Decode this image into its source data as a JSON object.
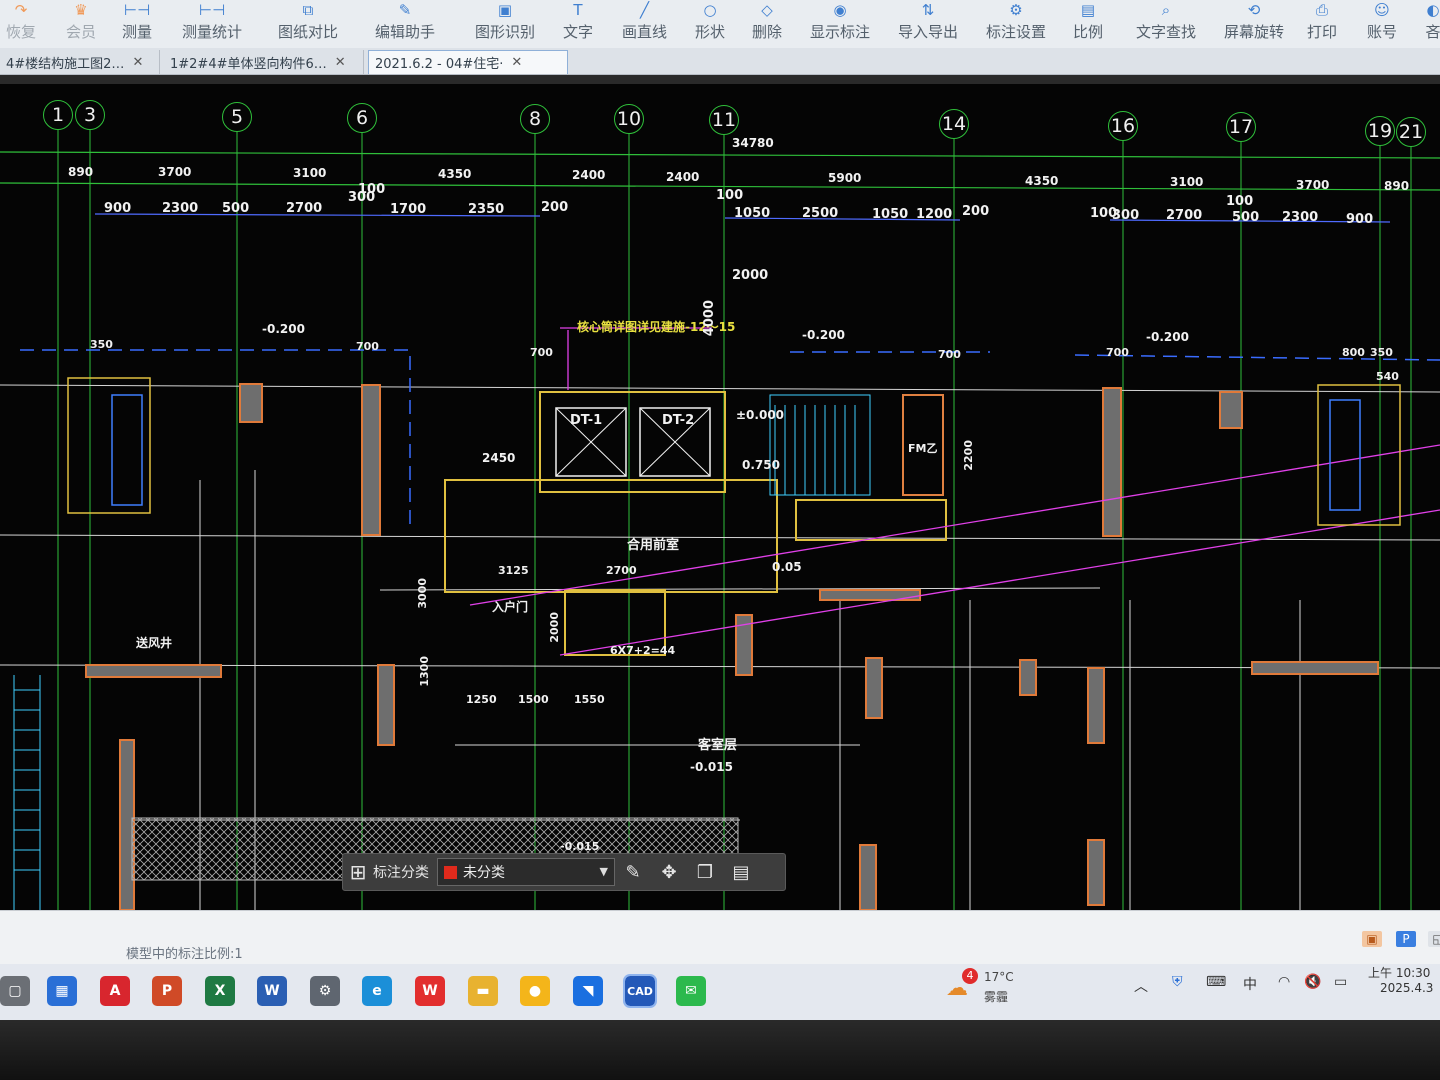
{
  "ribbon": {
    "items": [
      {
        "label": "恢复",
        "icon": "redo-icon",
        "dim": true
      },
      {
        "label": "会员",
        "icon": "vip-icon",
        "dim": true
      },
      {
        "label": "测量",
        "icon": "measure-icon"
      },
      {
        "label": "测量统计",
        "icon": "measure-stats-icon"
      },
      {
        "label": "图纸对比",
        "icon": "compare-icon"
      },
      {
        "label": "编辑助手",
        "icon": "edit-helper-icon"
      },
      {
        "label": "图形识别",
        "icon": "shape-recognize-icon"
      },
      {
        "label": "文字",
        "icon": "text-icon"
      },
      {
        "label": "画直线",
        "icon": "line-icon"
      },
      {
        "label": "形状",
        "icon": "shape-icon"
      },
      {
        "label": "删除",
        "icon": "eraser-icon"
      },
      {
        "label": "显示标注",
        "icon": "eye-icon"
      },
      {
        "label": "导入导出",
        "icon": "import-export-icon"
      },
      {
        "label": "标注设置",
        "icon": "annotation-settings-icon"
      },
      {
        "label": "比例",
        "icon": "scale-icon"
      },
      {
        "label": "文字查找",
        "icon": "text-search-icon"
      },
      {
        "label": "屏幕旋转",
        "icon": "rotate-screen-icon"
      },
      {
        "label": "打印",
        "icon": "printer-icon"
      },
      {
        "label": "账号",
        "icon": "account-icon"
      },
      {
        "label": "吝",
        "icon": "more-icon"
      }
    ]
  },
  "tabs": [
    {
      "label": "4#楼结构施工图2…",
      "active": false
    },
    {
      "label": "1#2#4#单体竖向构件6…",
      "active": false
    },
    {
      "label": "2021.6.2 - 04#住宅·",
      "active": true
    }
  ],
  "drawing": {
    "grid_axes": [
      "1",
      "3",
      "5",
      "6",
      "8",
      "10",
      "11",
      "14",
      "16",
      "17",
      "19",
      "21"
    ],
    "overall_dimension": "34780",
    "dim_row1": [
      "890",
      "3700",
      "3100",
      "4350",
      "2400",
      "2400",
      "5900",
      "4350",
      "3100",
      "3700",
      "890"
    ],
    "dim_row2_left": [
      "900",
      "2300",
      "500",
      "2700",
      "300",
      "100",
      "1700",
      "2350",
      "200"
    ],
    "dim_row2_right": [
      "100",
      "1050",
      "2500",
      "1050",
      "1200",
      "200",
      "100",
      "300",
      "2700",
      "100",
      "500",
      "2300",
      "900"
    ],
    "labels": {
      "core_note": "核心筒详图详见建施-12～15",
      "elev_a": "-0.200",
      "elev_b": "-0.200",
      "elev_c": "-0.200",
      "elev_zero": "±0.000",
      "elev_stair": "0.750",
      "elev_005": "0.05",
      "elev_015": "-0.015",
      "elev_neg015": "-0.015",
      "dt1": "DT-1",
      "dt2": "DT-2",
      "lobby": "合用前室",
      "room": "客室层",
      "hall": "入户门",
      "shaft": "送风井",
      "d4000": "4000",
      "d2000": "2000",
      "d2450": "2450",
      "d3125": "3125",
      "d2700": "2700",
      "d1250": "1250",
      "d1500": "1500",
      "d1550": "1550",
      "d3000": "3000",
      "d1300": "1300",
      "d2200": "2200",
      "d2000b": "2000",
      "d700a": "700",
      "d700b": "700",
      "d700c": "700",
      "d700d": "700",
      "d350": "350",
      "d800": "800",
      "d350b": "350",
      "d540": "540",
      "stairs_note": "6X7+2=44",
      "fm": "FM乙"
    }
  },
  "anno_bar": {
    "label": "标注分类",
    "value": "未分类",
    "swatch": "#e02a1c",
    "buttons": [
      "edit-annotation-icon",
      "move-icon",
      "copy-icon",
      "paste-icon"
    ]
  },
  "status": {
    "scale_text": "模型中的标注比例:1"
  },
  "taskbar": {
    "apps": [
      {
        "name": "task-view",
        "glyph": "▢",
        "bg": "#6b6f75"
      },
      {
        "name": "store",
        "glyph": "▦",
        "bg": "#2a6fd6"
      },
      {
        "name": "acrobat",
        "glyph": "A",
        "bg": "#d8262e"
      },
      {
        "name": "powerpoint",
        "glyph": "P",
        "bg": "#d04a27"
      },
      {
        "name": "excel",
        "glyph": "X",
        "bg": "#1f7a43"
      },
      {
        "name": "word",
        "glyph": "W",
        "bg": "#2b5fb3"
      },
      {
        "name": "settings",
        "glyph": "⚙",
        "bg": "#5f6670"
      },
      {
        "name": "edge",
        "glyph": "e",
        "bg": "#1b8fd8"
      },
      {
        "name": "wps",
        "glyph": "W",
        "bg": "#e22e2e"
      },
      {
        "name": "files",
        "glyph": "▬",
        "bg": "#e8b230"
      },
      {
        "name": "pinyin",
        "glyph": "●",
        "bg": "#f4b51a"
      },
      {
        "name": "tencent",
        "glyph": "◥",
        "bg": "#1a6fe0"
      },
      {
        "name": "cad",
        "glyph": "CAD",
        "bg": "#2459b8"
      },
      {
        "name": "wechat",
        "glyph": "✉",
        "bg": "#2cb94d"
      }
    ],
    "weather_badge": "4",
    "weather_temp": "17°C",
    "weather_desc": "雾霾",
    "ime": "中",
    "time": "上午 10:30",
    "date": "2025.4.3"
  }
}
